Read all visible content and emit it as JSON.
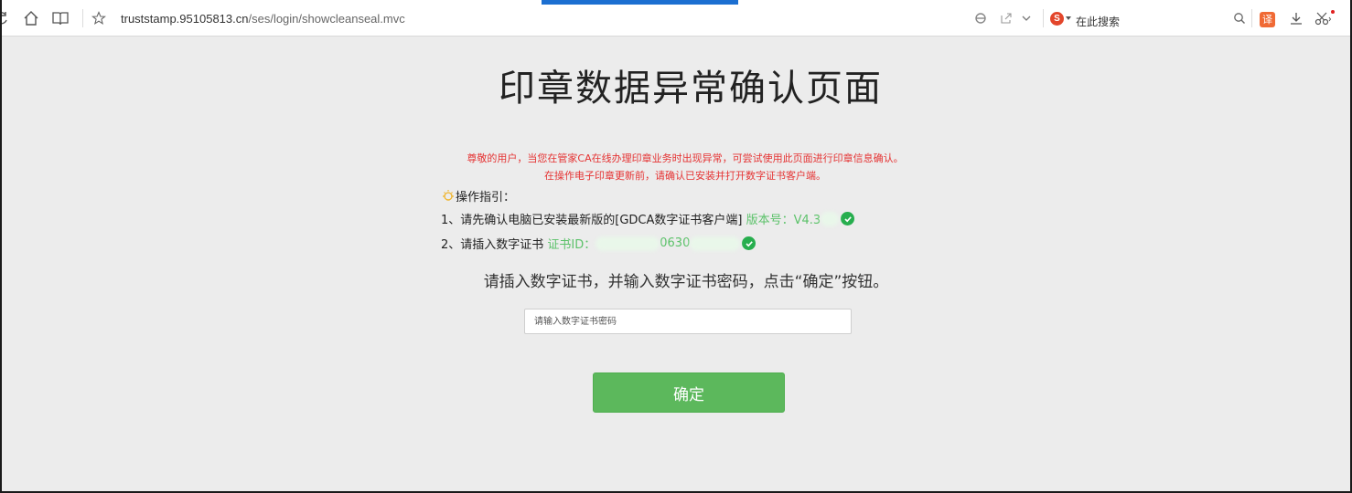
{
  "browser": {
    "url_host": "truststamp.95105813.cn",
    "url_path": "/ses/login/showcleanseal.mvc",
    "search_label": "在此搜索",
    "search_logo": "S",
    "translate_label": "译",
    "loading_color": "#1c6fd1"
  },
  "page": {
    "title": "印章数据异常确认页面",
    "notice_line1": "尊敬的用户，当您在管家CA在线办理印章业务时出现异常，可尝试使用此页面进行印章信息确认。",
    "notice_line2": "在操作电子印章更新前，请确认已安装并打开数字证书客户端。",
    "guide_title": "操作指引：",
    "step1_text": "1、请先确认电脑已安装最新版的[GDCA数字证书客户端] ",
    "step1_version": "版本号：V4.3",
    "step2_text": "2、请插入数字证书 ",
    "step2_cert_label": "证书ID：",
    "step2_cert_partial": "0630",
    "instruction": "请插入数字证书，并输入数字证书密码，点击“确定”按钮。",
    "password_placeholder": "请输入数字证书密码",
    "password_value": "",
    "confirm_label": "确定"
  },
  "colors": {
    "notice": "#e53333",
    "green_text": "#5cc26a",
    "check": "#27ae4e",
    "button": "#5cb85c",
    "background": "#ececec"
  },
  "icons": [
    "refresh-icon",
    "home-icon",
    "reader-icon",
    "star-icon",
    "ie-mode-icon",
    "share-icon",
    "chevron-down-icon",
    "sogou-search-icon",
    "search-icon",
    "translate-icon",
    "download-icon",
    "screenshot-scissors-icon",
    "bulb-icon",
    "check-circle-icon"
  ]
}
